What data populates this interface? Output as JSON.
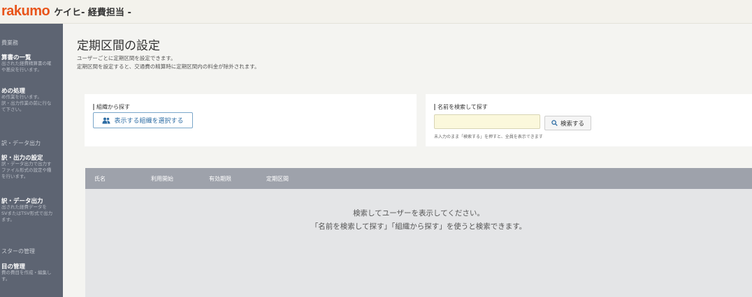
{
  "header": {
    "logo": "rakumo",
    "app_name": "ケイヒ",
    "role": "- 経費担当 -"
  },
  "sidebar": {
    "sections": [
      {
        "label": "費業務",
        "items": [
          {
            "title": "算書の一覧",
            "desc": [
              "出された経費精算書の確",
              "や差戻を行います。"
            ]
          },
          {
            "title": "めの処理",
            "desc": [
              "め作業を行います。",
              "訳・出力作業の前に行な",
              "て下さい。"
            ]
          }
        ]
      },
      {
        "label": "訳・データ出力",
        "items": [
          {
            "title": "訳・出力の設定",
            "desc": [
              "訳・データ出力で出力す",
              "ファイル形式の設定や種",
              "を行います。"
            ]
          },
          {
            "title": "訳・データ出力",
            "desc": [
              "出された経費データを",
              "SVまたはTSV形式で出力",
              "ます。"
            ]
          }
        ]
      },
      {
        "label": "スターの管理",
        "items": [
          {
            "title": "目の管理",
            "desc": [
              "費の費目を作成・編集し",
              "す。"
            ]
          }
        ]
      }
    ]
  },
  "page": {
    "title": "定期区間の設定",
    "desc_line1": "ユーザーごとに定期区間を設定できます。",
    "desc_line2": "定期区間を設定すると、交通費の精算時に定期区間内の料金が除外されます。"
  },
  "org_panel": {
    "label": "組織から探す",
    "button_label": "表示する組織を選択する",
    "button_icon": "users-icon"
  },
  "name_panel": {
    "label": "名前を検索して探す",
    "input_value": "",
    "input_placeholder": "",
    "search_button_label": "検索する",
    "search_icon": "search-icon",
    "hint": "未入力のまま「検索する」を押すと、全員を表示できます"
  },
  "table": {
    "columns": [
      "氏名",
      "利用開始",
      "有効期限",
      "定期区間"
    ],
    "empty_line1": "検索してユーザーを表示してください。",
    "empty_line2": "「名前を検索して探す」「組織から探す」を使うと検索できます。"
  },
  "colors": {
    "brand": "#e8541a",
    "sidebar_bg": "#5d6472",
    "table_header_bg": "#9ea2ab",
    "table_body_bg": "#e4e5e7",
    "link_blue": "#2e6da4",
    "input_bg": "#fbf8dc"
  }
}
